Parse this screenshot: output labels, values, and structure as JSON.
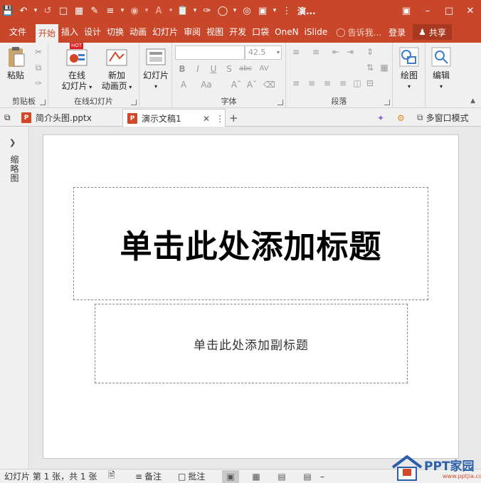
{
  "titlebar": {
    "title": "演...",
    "quick_access": [
      "save-icon",
      "undo-icon",
      "redo-icon",
      "new-icon",
      "layout-icon",
      "eyedropper-icon",
      "align-icon",
      "shape-fill-icon",
      "font-color-icon",
      "paste-icon",
      "brush-icon",
      "circle-icon",
      "target-icon",
      "theme-icon"
    ],
    "window_buttons": [
      "ribbon-display-icon",
      "minimize-icon",
      "restore-icon",
      "close-icon"
    ]
  },
  "ribbon_tabs": [
    "文件",
    "开始",
    "插入",
    "设计",
    "切换",
    "动画",
    "幻灯片",
    "审阅",
    "视图",
    "开发",
    "口袋",
    "OneN",
    "iSlide"
  ],
  "tell_me": "告诉我...",
  "login": "登录",
  "share": "共享",
  "ribbon": {
    "clipboard": {
      "paste": "粘贴",
      "label": "剪贴板"
    },
    "online_slides": {
      "online_btn_line1": "在线",
      "online_btn_line2": "幻灯片",
      "hot_badge": "HOT",
      "new_btn_line1": "新加",
      "new_btn_line2": "动画页",
      "label": "在线幻灯片"
    },
    "slides": {
      "slide_btn": "幻灯片"
    },
    "font": {
      "font_name": "",
      "font_size": "42.5",
      "label": "字体",
      "bold": "B",
      "italic": "I",
      "underline": "U",
      "shadow": "S",
      "strike": "abc",
      "spacing": "AV",
      "case": "Aa",
      "color": "A"
    },
    "paragraph": {
      "label": "段落"
    },
    "drawing": {
      "label": "绘图"
    },
    "editing": {
      "label": "编辑"
    }
  },
  "doc_tabs": [
    {
      "name": "简介头图.pptx",
      "active": false
    },
    {
      "name": "演示文稿1",
      "active": true
    }
  ],
  "multi_window": "多窗口模式",
  "left_pane_label": "缩略图",
  "slide": {
    "title_placeholder": "单击此处添加标题",
    "subtitle_placeholder": "单击此处添加副标题"
  },
  "status": {
    "slide_info": "幻灯片 第 1 张，共 1 张",
    "notes": "备注",
    "comments": "批注"
  },
  "watermark": {
    "text": "PPT家园",
    "url": "www.pptjia.com"
  },
  "colors": {
    "accent": "#c8472a"
  }
}
